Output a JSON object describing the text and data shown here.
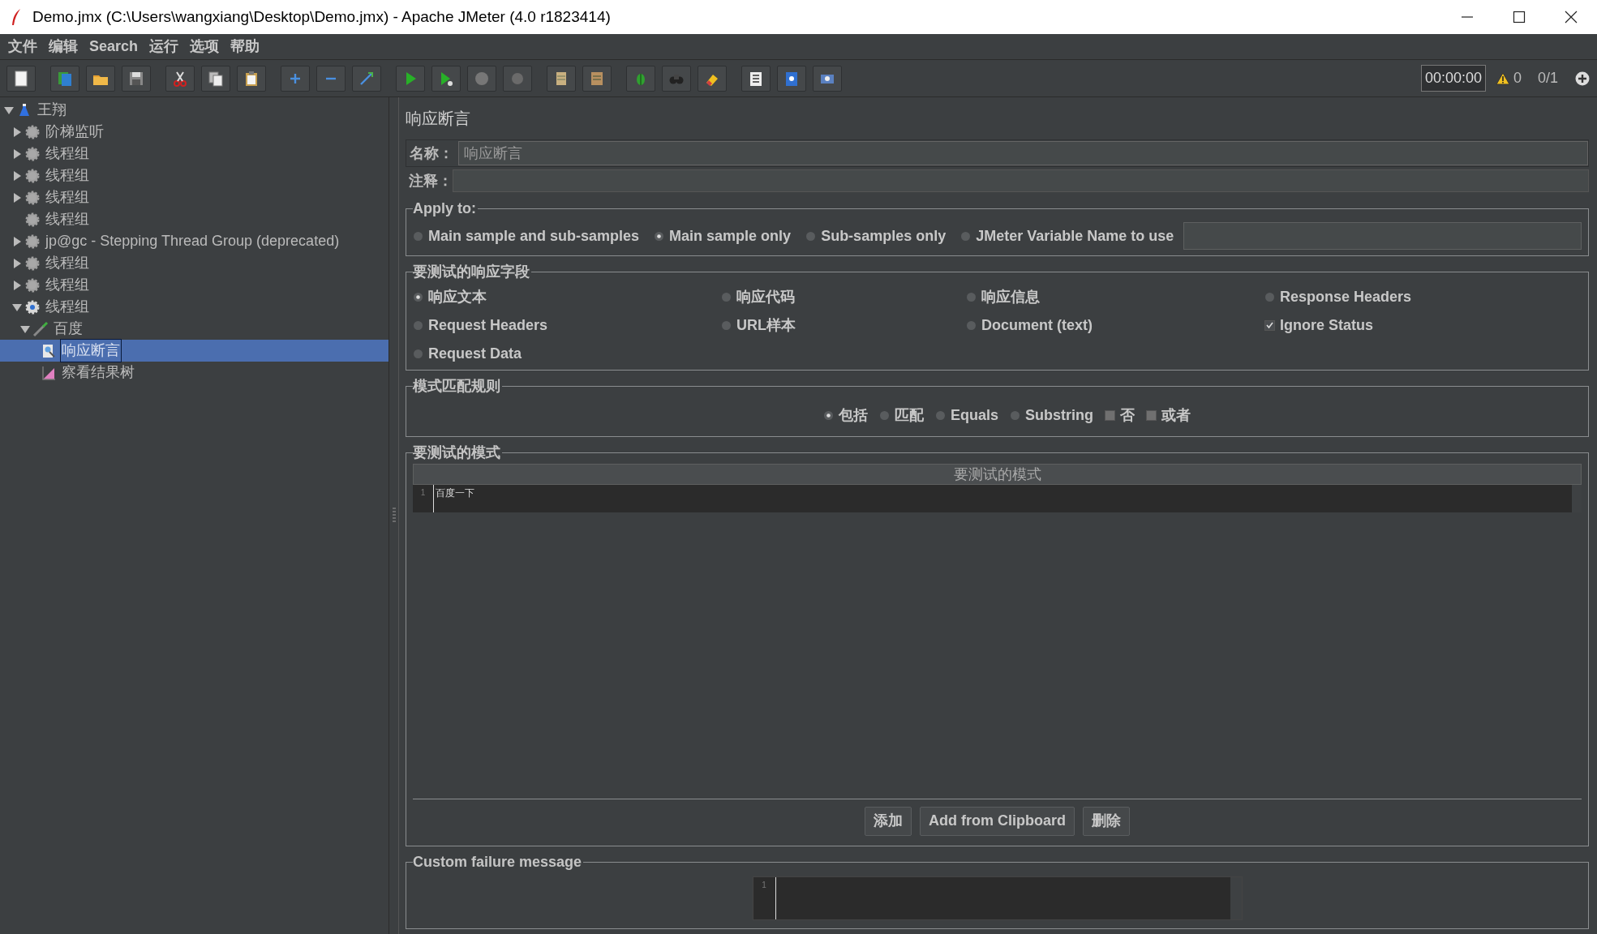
{
  "window": {
    "title": "Demo.jmx (C:\\Users\\wangxiang\\Desktop\\Demo.jmx) - Apache JMeter (4.0 r1823414)"
  },
  "menu": [
    "文件",
    "编辑",
    "Search",
    "运行",
    "选项",
    "帮助"
  ],
  "toolbar": {
    "timer": "00:00:00",
    "warnings": "0",
    "threads": "0/1"
  },
  "tree": [
    {
      "label": "王翔",
      "kind": "plan",
      "expanded": true,
      "selected": false,
      "children": [
        {
          "label": "阶梯监听",
          "kind": "group",
          "expanded": false,
          "selected": false
        },
        {
          "label": "线程组",
          "kind": "group",
          "expanded": false,
          "selected": false
        },
        {
          "label": "线程组",
          "kind": "group",
          "expanded": false,
          "selected": false
        },
        {
          "label": "线程组",
          "kind": "group",
          "expanded": false,
          "selected": false
        },
        {
          "label": "线程组",
          "kind": "group",
          "selected": false
        },
        {
          "label": "jp@gc - Stepping Thread Group (deprecated)",
          "kind": "group",
          "expanded": false,
          "selected": false
        },
        {
          "label": "线程组",
          "kind": "group",
          "expanded": false,
          "selected": false
        },
        {
          "label": "线程组",
          "kind": "group",
          "expanded": false,
          "selected": false
        },
        {
          "label": "线程组",
          "kind": "active-group",
          "expanded": true,
          "selected": false,
          "children": [
            {
              "label": "百度",
              "kind": "sampler",
              "expanded": true,
              "selected": false,
              "children": [
                {
                  "label": "响应断言",
                  "kind": "assertion",
                  "selected": true
                },
                {
                  "label": "察看结果树",
                  "kind": "listener",
                  "selected": false
                }
              ]
            }
          ]
        }
      ]
    }
  ],
  "panel": {
    "title": "响应断言",
    "name_label": "名称：",
    "name_value": "响应断言",
    "comment_label": "注释：",
    "apply_to": {
      "legend": "Apply to:",
      "options": [
        {
          "label": "Main sample and sub-samples",
          "selected": false
        },
        {
          "label": "Main sample only",
          "selected": true
        },
        {
          "label": "Sub-samples only",
          "selected": false
        },
        {
          "label": "JMeter Variable Name to use",
          "selected": false
        }
      ]
    },
    "response_field": {
      "legend": "要测试的响应字段",
      "options": [
        {
          "label": "响应文本",
          "kind": "radio",
          "selected": true
        },
        {
          "label": "响应代码",
          "kind": "radio",
          "selected": false
        },
        {
          "label": "响应信息",
          "kind": "radio",
          "selected": false
        },
        {
          "label": "Response Headers",
          "kind": "radio",
          "selected": false
        },
        {
          "label": "Request Headers",
          "kind": "radio",
          "selected": false
        },
        {
          "label": "URL样本",
          "kind": "radio",
          "selected": false
        },
        {
          "label": "Document (text)",
          "kind": "radio",
          "selected": false
        },
        {
          "label": "Ignore Status",
          "kind": "checkbox",
          "checked": true
        },
        {
          "label": "Request Data",
          "kind": "radio",
          "selected": false
        }
      ]
    },
    "pattern_rules": {
      "legend": "模式匹配规则",
      "options": [
        {
          "label": "包括",
          "kind": "radio",
          "selected": true
        },
        {
          "label": "匹配",
          "kind": "radio",
          "selected": false
        },
        {
          "label": "Equals",
          "kind": "radio",
          "selected": false
        },
        {
          "label": "Substring",
          "kind": "radio",
          "selected": false
        },
        {
          "label": "否",
          "kind": "checkbox",
          "checked": false
        },
        {
          "label": "或者",
          "kind": "checkbox",
          "checked": false
        }
      ]
    },
    "patterns": {
      "legend": "要测试的模式",
      "header": "要测试的模式",
      "rows": [
        {
          "line": "1",
          "text": "百度一下"
        }
      ],
      "buttons": [
        "添加",
        "Add from Clipboard",
        "删除"
      ]
    },
    "failure_message": {
      "legend": "Custom failure message",
      "line": "1"
    }
  }
}
